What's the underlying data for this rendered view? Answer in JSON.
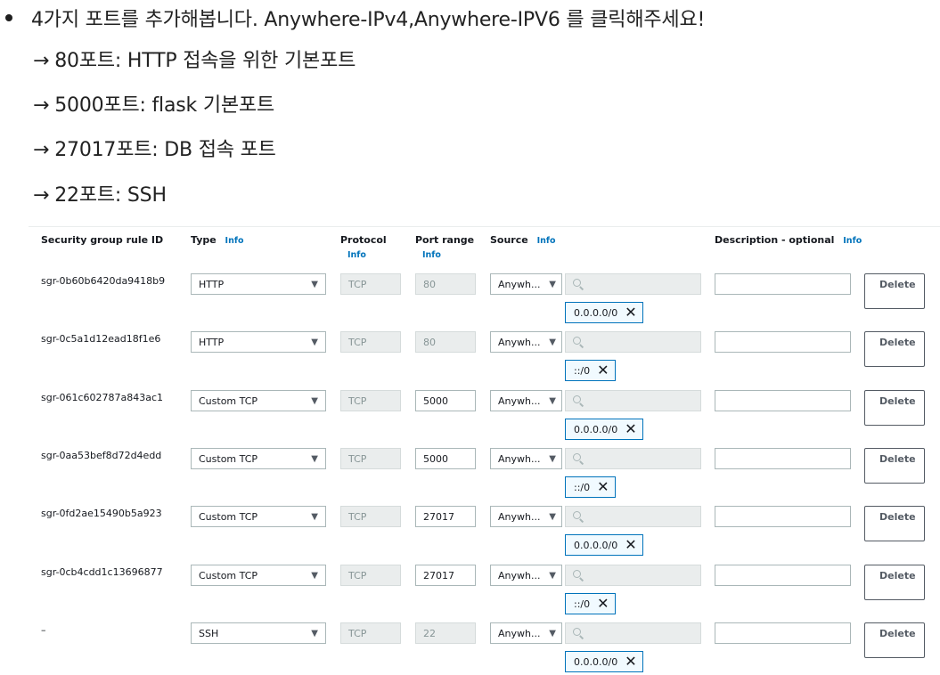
{
  "note": {
    "bullet": "4가지 포트를 추가해봅니다. Anywhere-IPv4,Anywhere-IPV6 를 클릭해주세요!",
    "arrow": "→",
    "lines": [
      "80포트: HTTP 접속을 위한 기본포트",
      "5000포트: flask 기본포트",
      "27017포트: DB 접속 포트",
      "22포트: SSH"
    ]
  },
  "table": {
    "headers": {
      "rule_id": "Security group rule ID",
      "type": "Type",
      "protocol": "Protocol",
      "port_range": "Port range",
      "source": "Source",
      "description": "Description - optional",
      "info": "Info"
    },
    "delete_label": "Delete",
    "rows": [
      {
        "id": "sgr-0b60b6420da9418b9",
        "type": "HTTP",
        "protocol": "TCP",
        "port": "80",
        "source": "Anywh...",
        "cidr": "0.0.0.0/0"
      },
      {
        "id": "sgr-0c5a1d12ead18f1e6",
        "type": "HTTP",
        "protocol": "TCP",
        "port": "80",
        "source": "Anywh...",
        "cidr": "::/0"
      },
      {
        "id": "sgr-061c602787a843ac1",
        "type": "Custom TCP",
        "protocol": "TCP",
        "port": "5000",
        "source": "Anywh...",
        "cidr": "0.0.0.0/0"
      },
      {
        "id": "sgr-0aa53bef8d72d4edd",
        "type": "Custom TCP",
        "protocol": "TCP",
        "port": "5000",
        "source": "Anywh...",
        "cidr": "::/0"
      },
      {
        "id": "sgr-0fd2ae15490b5a923",
        "type": "Custom TCP",
        "protocol": "TCP",
        "port": "27017",
        "source": "Anywh...",
        "cidr": "0.0.0.0/0"
      },
      {
        "id": "sgr-0cb4cdd1c13696877",
        "type": "Custom TCP",
        "protocol": "TCP",
        "port": "27017",
        "source": "Anywh...",
        "cidr": "::/0"
      },
      {
        "id": "–",
        "type": "SSH",
        "protocol": "TCP",
        "port": "22",
        "source": "Anywh...",
        "cidr": "0.0.0.0/0"
      }
    ]
  }
}
